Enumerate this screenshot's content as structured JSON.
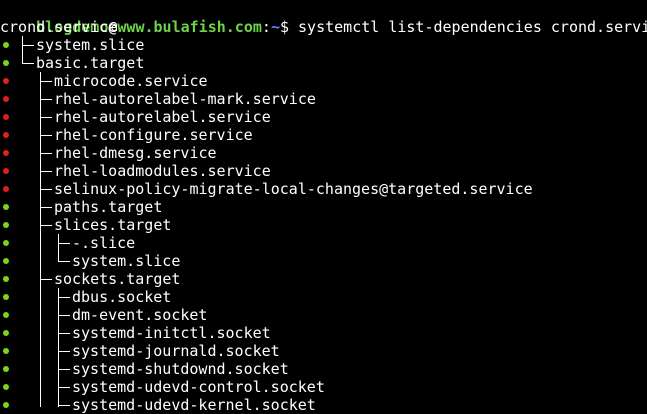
{
  "prompt": {
    "user": "blogdemo",
    "at": "@",
    "host": "www.bulafish.com",
    "sep": ":",
    "path": "~",
    "symbol": "$",
    "command": " systemctl list-dependencies crond.service"
  },
  "root_unit": "crond.service",
  "colors": {
    "active": "#7ed321",
    "inactive": "#e02020",
    "prompt_user": "#6ed34a",
    "prompt_path": "#6b7fff"
  },
  "tree": [
    {
      "label": "system.slice",
      "depth": 0,
      "status": "active"
    },
    {
      "label": "basic.target",
      "depth": 0,
      "status": "active"
    },
    {
      "label": "microcode.service",
      "depth": 1,
      "status": "inactive"
    },
    {
      "label": "rhel-autorelabel-mark.service",
      "depth": 1,
      "status": "inactive"
    },
    {
      "label": "rhel-autorelabel.service",
      "depth": 1,
      "status": "inactive"
    },
    {
      "label": "rhel-configure.service",
      "depth": 1,
      "status": "inactive"
    },
    {
      "label": "rhel-dmesg.service",
      "depth": 1,
      "status": "inactive"
    },
    {
      "label": "rhel-loadmodules.service",
      "depth": 1,
      "status": "inactive"
    },
    {
      "label": "selinux-policy-migrate-local-changes@targeted.service",
      "depth": 1,
      "status": "inactive"
    },
    {
      "label": "paths.target",
      "depth": 1,
      "status": "active"
    },
    {
      "label": "slices.target",
      "depth": 1,
      "status": "active"
    },
    {
      "label": "-.slice",
      "depth": 2,
      "status": "active"
    },
    {
      "label": "system.slice",
      "depth": 2,
      "status": "active"
    },
    {
      "label": "sockets.target",
      "depth": 1,
      "status": "active"
    },
    {
      "label": "dbus.socket",
      "depth": 2,
      "status": "active"
    },
    {
      "label": "dm-event.socket",
      "depth": 2,
      "status": "active"
    },
    {
      "label": "systemd-initctl.socket",
      "depth": 2,
      "status": "active"
    },
    {
      "label": "systemd-journald.socket",
      "depth": 2,
      "status": "active"
    },
    {
      "label": "systemd-shutdownd.socket",
      "depth": 2,
      "status": "active"
    },
    {
      "label": "systemd-udevd-control.socket",
      "depth": 2,
      "status": "active"
    },
    {
      "label": "systemd-udevd-kernel.socket",
      "depth": 2,
      "status": "active"
    }
  ]
}
